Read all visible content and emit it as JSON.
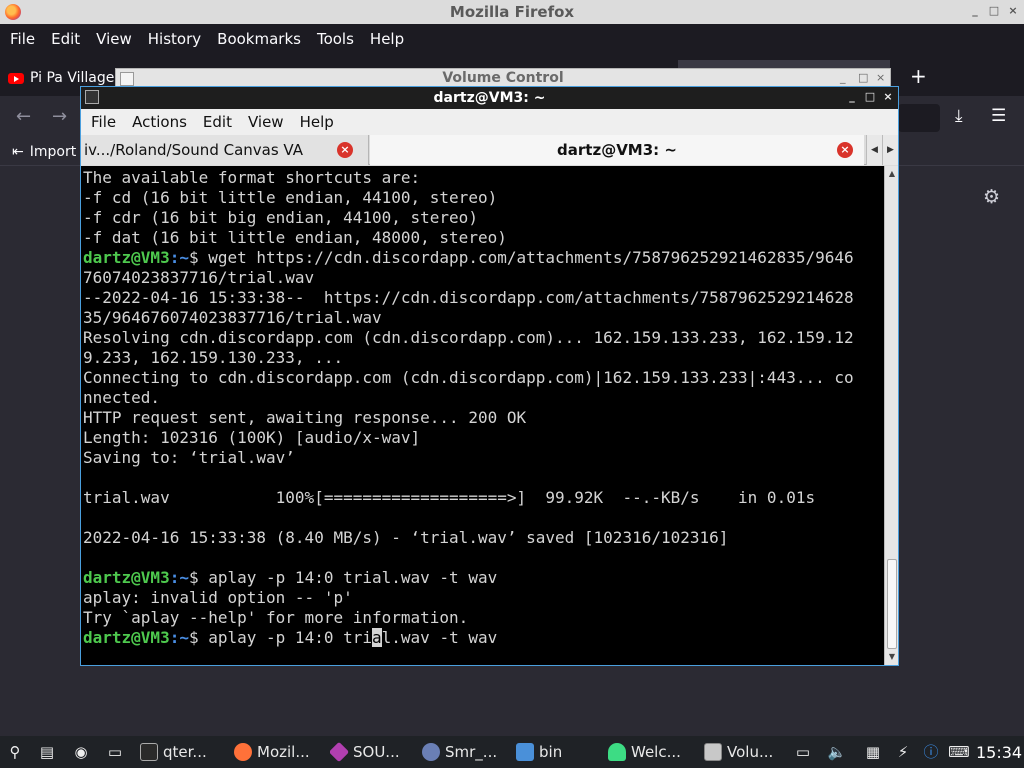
{
  "firefox": {
    "window_title": "Mozilla Firefox",
    "menu": [
      "File",
      "Edit",
      "View",
      "History",
      "Bookmarks",
      "Tools",
      "Help"
    ],
    "tab_title": "Pi Pa Village",
    "new_tab_icon": "+",
    "import_label": "Import",
    "controls": {
      "minimize": "_",
      "maximize": "□",
      "close": "×"
    }
  },
  "volume_control": {
    "window_title": "Volume Control"
  },
  "terminal": {
    "window_title": "dartz@VM3: ~",
    "menu": [
      "File",
      "Actions",
      "Edit",
      "View",
      "Help"
    ],
    "tabs": [
      {
        "label": "iv.../Roland/Sound Canvas VA"
      },
      {
        "label": "dartz@VM3: ~"
      }
    ],
    "prompt_user": "dartz@VM3",
    "prompt_path": ":~",
    "prompt_symbol": "$ ",
    "lines": [
      {
        "type": "text",
        "text": "The available format shortcuts are:"
      },
      {
        "type": "text",
        "text": "-f cd (16 bit little endian, 44100, stereo)"
      },
      {
        "type": "text",
        "text": "-f cdr (16 bit big endian, 44100, stereo)"
      },
      {
        "type": "text",
        "text": "-f dat (16 bit little endian, 48000, stereo)"
      },
      {
        "type": "prompt",
        "text": "wget https://cdn.discordapp.com/attachments/758796252921462835/9646"
      },
      {
        "type": "text",
        "text": "76074023837716/trial.wav"
      },
      {
        "type": "text",
        "text": "--2022-04-16 15:33:38--  https://cdn.discordapp.com/attachments/7587962529214628"
      },
      {
        "type": "text",
        "text": "35/964676074023837716/trial.wav"
      },
      {
        "type": "text",
        "text": "Resolving cdn.discordapp.com (cdn.discordapp.com)... 162.159.133.233, 162.159.12"
      },
      {
        "type": "text",
        "text": "9.233, 162.159.130.233, ..."
      },
      {
        "type": "text",
        "text": "Connecting to cdn.discordapp.com (cdn.discordapp.com)|162.159.133.233|:443... co"
      },
      {
        "type": "text",
        "text": "nnected."
      },
      {
        "type": "text",
        "text": "HTTP request sent, awaiting response... 200 OK"
      },
      {
        "type": "text",
        "text": "Length: 102316 (100K) [audio/x-wav]"
      },
      {
        "type": "text",
        "text": "Saving to: ‘trial.wav’"
      },
      {
        "type": "text",
        "text": ""
      },
      {
        "type": "text",
        "text": "trial.wav           100%[===================>]  99.92K  --.-KB/s    in 0.01s"
      },
      {
        "type": "text",
        "text": ""
      },
      {
        "type": "text",
        "text": "2022-04-16 15:33:38 (8.40 MB/s) - ‘trial.wav’ saved [102316/102316]"
      },
      {
        "type": "text",
        "text": ""
      },
      {
        "type": "prompt",
        "text": "aplay -p 14:0 trial.wav -t wav"
      },
      {
        "type": "text",
        "text": "aplay: invalid option -- 'p'"
      },
      {
        "type": "text",
        "text": "Try `aplay --help' for more information."
      },
      {
        "type": "prompt_cursor",
        "before": "aplay -p 14:0 tri",
        "cursor": "a",
        "after": "l.wav -t wav"
      }
    ]
  },
  "taskbar": {
    "tasks": [
      {
        "label": "qter...",
        "icon": "terminal-icon",
        "color": "#3a3a3a"
      },
      {
        "label": "Mozil...",
        "icon": "firefox-icon",
        "color": "#ff7139"
      },
      {
        "label": "SOU...",
        "icon": "diamond-icon",
        "color": "#b13fb0"
      },
      {
        "label": "Smr_...",
        "icon": "wine-app-icon",
        "color": "#6a7fb5"
      },
      {
        "label": "bin",
        "icon": "folder-icon",
        "color": "#4a90d9"
      },
      {
        "label": "Welc...",
        "icon": "android-icon",
        "color": "#3ddc84"
      },
      {
        "label": "Volu...",
        "icon": "volume-app-icon",
        "color": "#c8c8c8"
      }
    ],
    "clock": "15:34"
  }
}
